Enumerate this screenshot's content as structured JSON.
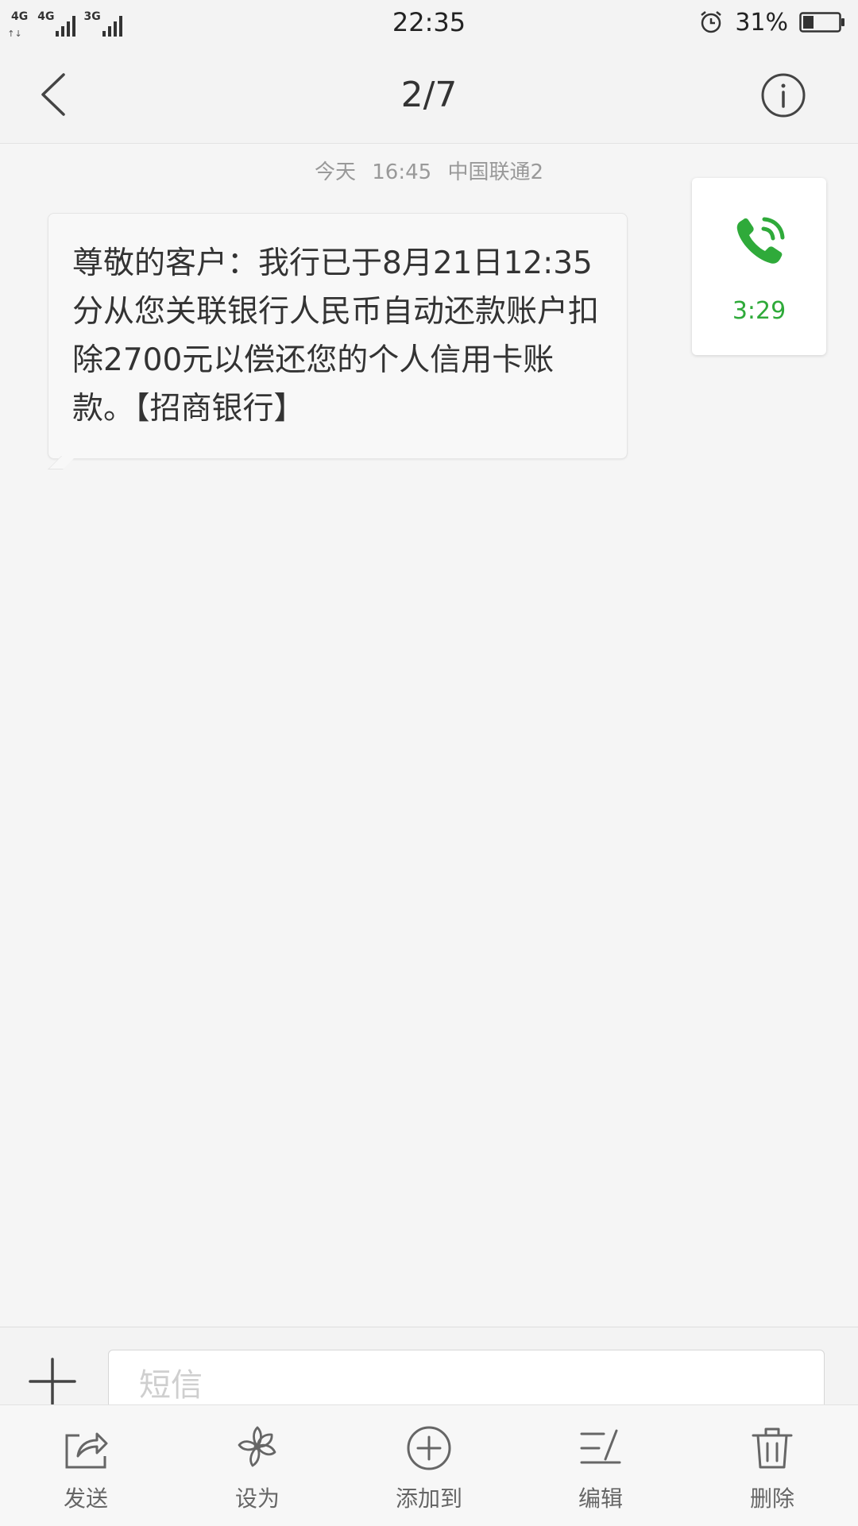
{
  "status_bar": {
    "network_1": "4G",
    "network_2": "4G",
    "network_3": "3G",
    "data_arrows": "↑↓",
    "time": "22:35",
    "battery_percent": "31%",
    "battery_level": 0.31,
    "icons": [
      "signal-icon",
      "alarm-icon",
      "battery-icon"
    ]
  },
  "header": {
    "title": "2/7",
    "back_icon": "chevron-left-icon",
    "info_icon": "info-circle-icon"
  },
  "message": {
    "date": "今天",
    "time": "16:45",
    "carrier": "中国联通2",
    "text": "尊敬的客户：我行已于8月21日12:35分从您关联银行人民币自动还款账户扣除2700元以偿还您的个人信用卡账款。【招商银行】"
  },
  "call_card": {
    "icon": "phone-call-icon",
    "duration": "3:29",
    "color": "#2faa3a"
  },
  "input_bar": {
    "add_icon": "plus-icon",
    "placeholder": "短信"
  },
  "toolbar": {
    "items": [
      {
        "icon": "share-icon",
        "label": "发送"
      },
      {
        "icon": "flower-icon",
        "label": "设为"
      },
      {
        "icon": "plus-circle-icon",
        "label": "添加到"
      },
      {
        "icon": "edit-icon",
        "label": "编辑"
      },
      {
        "icon": "trash-icon",
        "label": "删除"
      }
    ]
  }
}
